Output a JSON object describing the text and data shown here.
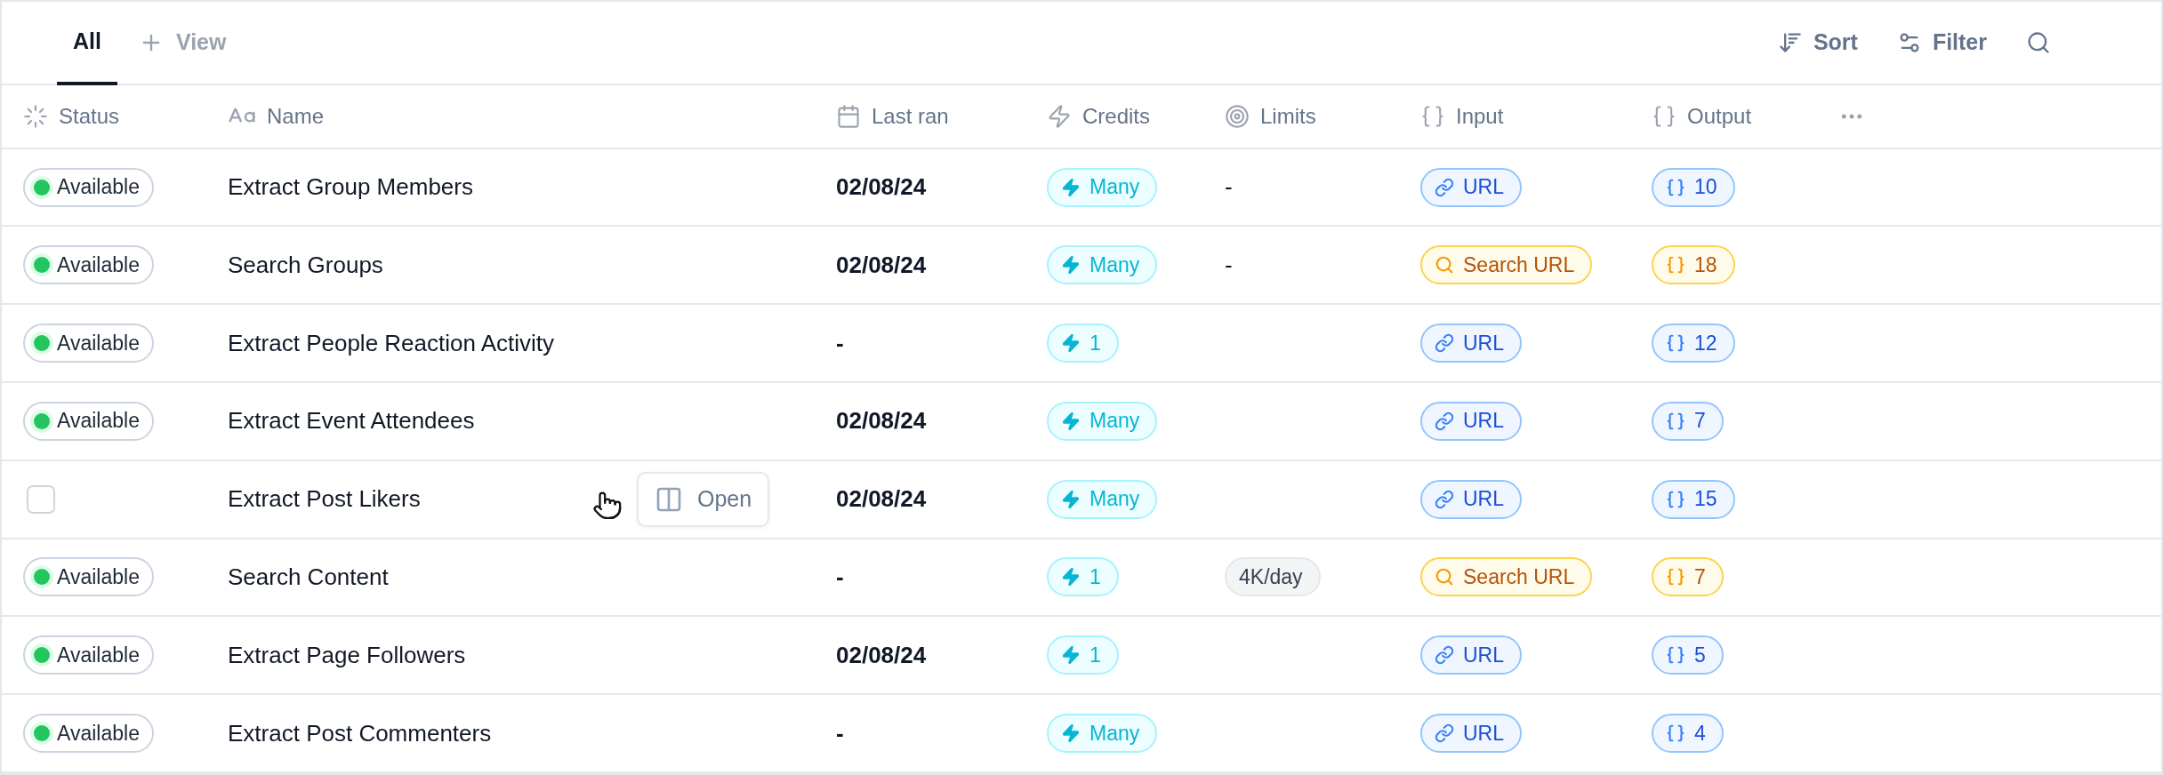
{
  "tabs": [
    {
      "label": "All",
      "selected": true
    }
  ],
  "add_view": "View",
  "toolbar": [
    {
      "kind": "sort",
      "label": "Sort"
    },
    {
      "kind": "filter",
      "label": "Filter"
    },
    {
      "kind": "search"
    }
  ],
  "columns": [
    {
      "kind": "status",
      "label": "Status"
    },
    {
      "kind": "text",
      "label": "Name"
    },
    {
      "kind": "date",
      "label": "Last ran"
    },
    {
      "kind": "credits",
      "label": "Credits"
    },
    {
      "kind": "limits",
      "label": "Limits"
    },
    {
      "kind": "json",
      "label": "Input"
    },
    {
      "kind": "json",
      "label": "Output"
    },
    {
      "kind": "more"
    }
  ],
  "rows": [
    {
      "status": {
        "kind": "badge",
        "label": "Available"
      },
      "name": "Extract Group Members",
      "last_ran": "02/08/24",
      "credits": "Many",
      "limits": {
        "kind": "text",
        "label": "-"
      },
      "input": {
        "kind": "link",
        "label": "URL"
      },
      "output": {
        "kind": "link",
        "label": "10"
      }
    },
    {
      "status": {
        "kind": "badge",
        "label": "Available"
      },
      "name": "Search Groups",
      "last_ran": "02/08/24",
      "credits": "Many",
      "limits": {
        "kind": "text",
        "label": "-"
      },
      "input": {
        "kind": "search",
        "label": "Search URL"
      },
      "output": {
        "kind": "search",
        "label": "18"
      }
    },
    {
      "status": {
        "kind": "badge",
        "label": "Available"
      },
      "name": "Extract People Reaction Activity",
      "last_ran": "-",
      "credits": "1",
      "input": {
        "kind": "link",
        "label": "URL"
      },
      "output": {
        "kind": "link",
        "label": "12"
      }
    },
    {
      "status": {
        "kind": "badge",
        "label": "Available"
      },
      "name": "Extract Event Attendees",
      "last_ran": "02/08/24",
      "credits": "Many",
      "input": {
        "kind": "link",
        "label": "URL"
      },
      "output": {
        "kind": "link",
        "label": "7"
      }
    },
    {
      "status": {
        "kind": "checkbox",
        "checked": false
      },
      "name": "Extract Post Likers",
      "action": "Open",
      "last_ran": "02/08/24",
      "credits": "Many",
      "input": {
        "kind": "link",
        "label": "URL"
      },
      "output": {
        "kind": "link",
        "label": "15"
      }
    },
    {
      "status": {
        "kind": "badge",
        "label": "Available"
      },
      "name": "Search Content",
      "last_ran": "-",
      "credits": "1",
      "limits": {
        "kind": "pill",
        "label": "4K/day"
      },
      "input": {
        "kind": "search",
        "label": "Search URL"
      },
      "output": {
        "kind": "search",
        "label": "7"
      }
    },
    {
      "status": {
        "kind": "badge",
        "label": "Available"
      },
      "name": "Extract Page Followers",
      "last_ran": "02/08/24",
      "credits": "1",
      "input": {
        "kind": "link",
        "label": "URL"
      },
      "output": {
        "kind": "link",
        "label": "5"
      }
    },
    {
      "status": {
        "kind": "badge",
        "label": "Available"
      },
      "name": "Extract Post Commenters",
      "last_ran": "-",
      "credits": "Many",
      "input": {
        "kind": "link",
        "label": "URL"
      },
      "output": {
        "kind": "link",
        "label": "4"
      }
    }
  ]
}
